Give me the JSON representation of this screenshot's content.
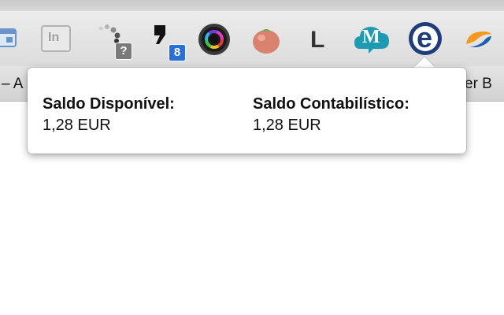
{
  "bookmarks_bar": {
    "left_text": "– A",
    "right_text": "er B"
  },
  "toolbar": {
    "extensions": [
      {
        "icon": "web-clip-icon"
      },
      {
        "icon": "linkedin-icon",
        "label": "In"
      },
      {
        "icon": "loading-dots-icon",
        "badge": "?"
      },
      {
        "icon": "quote-icon",
        "badge": "8"
      },
      {
        "icon": "color-wheel-icon"
      },
      {
        "icon": "tomato-icon"
      },
      {
        "icon": "letter-l-icon",
        "label": "L"
      },
      {
        "icon": "m-cloud-icon",
        "label": "M"
      },
      {
        "icon": "e-logo-icon",
        "label": "e"
      },
      {
        "icon": "partial-logo-icon"
      }
    ]
  },
  "popup": {
    "available_balance_label": "Saldo Disponível:",
    "available_balance_value": "1,28 EUR",
    "accounting_balance_label": "Saldo Contabilístico:",
    "accounting_balance_value": "1,28 EUR"
  },
  "colors": {
    "badge_blue": "#2a6fd6",
    "badge_gray": "#7a7a7a",
    "m_icon_teal": "#1e9bb0",
    "e_icon_navy": "#1f3d7a",
    "orange_logo": "#f39a1e"
  }
}
